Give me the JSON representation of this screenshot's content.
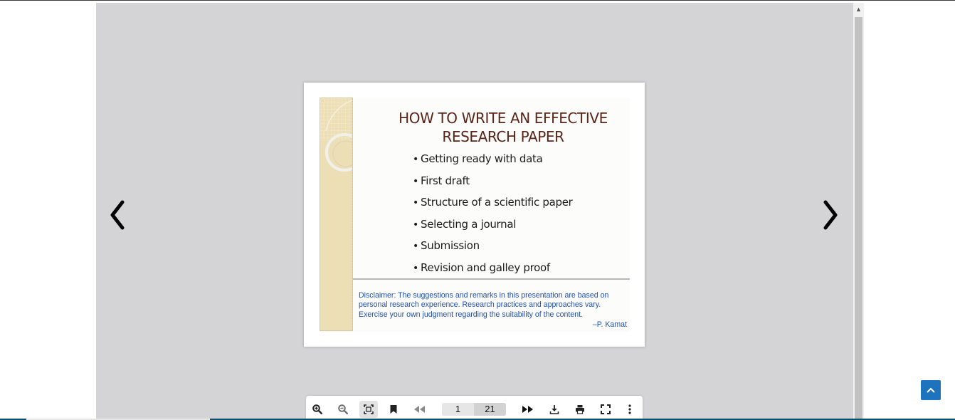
{
  "slide": {
    "title_line1": "HOW TO WRITE AN EFFECTIVE",
    "title_line2": "RESEARCH PAPER",
    "bullets": [
      "Getting ready with data",
      "First draft",
      "Structure of a scientific paper",
      "Selecting a journal",
      "Submission",
      "Revision and galley proof"
    ],
    "disclaimer_line1": "Disclaimer: The suggestions and remarks in this presentation are based on",
    "disclaimer_line2": "personal research experience. Research practices and approaches vary.",
    "disclaimer_line3": "Exercise your own judgment regarding the suitability of the content.",
    "author": "–P. Kamat"
  },
  "toolbar": {
    "current_page": "1",
    "total_pages": "21",
    "icons": [
      "zoom-in-icon",
      "zoom-out-icon",
      "fit-page-icon",
      "bookmark-icon",
      "first-page-icon",
      "last-page-icon",
      "download-icon",
      "print-icon",
      "fullscreen-icon",
      "more-options-icon"
    ]
  },
  "navigation": {
    "prev_icon": "chevron-left-icon",
    "next_icon": "chevron-right-icon"
  },
  "colors": {
    "viewer_background": "#d4d4d6",
    "slide_title": "#5a2418",
    "disclaimer_text": "#1f4fae",
    "back_to_top": "#1e73be"
  }
}
